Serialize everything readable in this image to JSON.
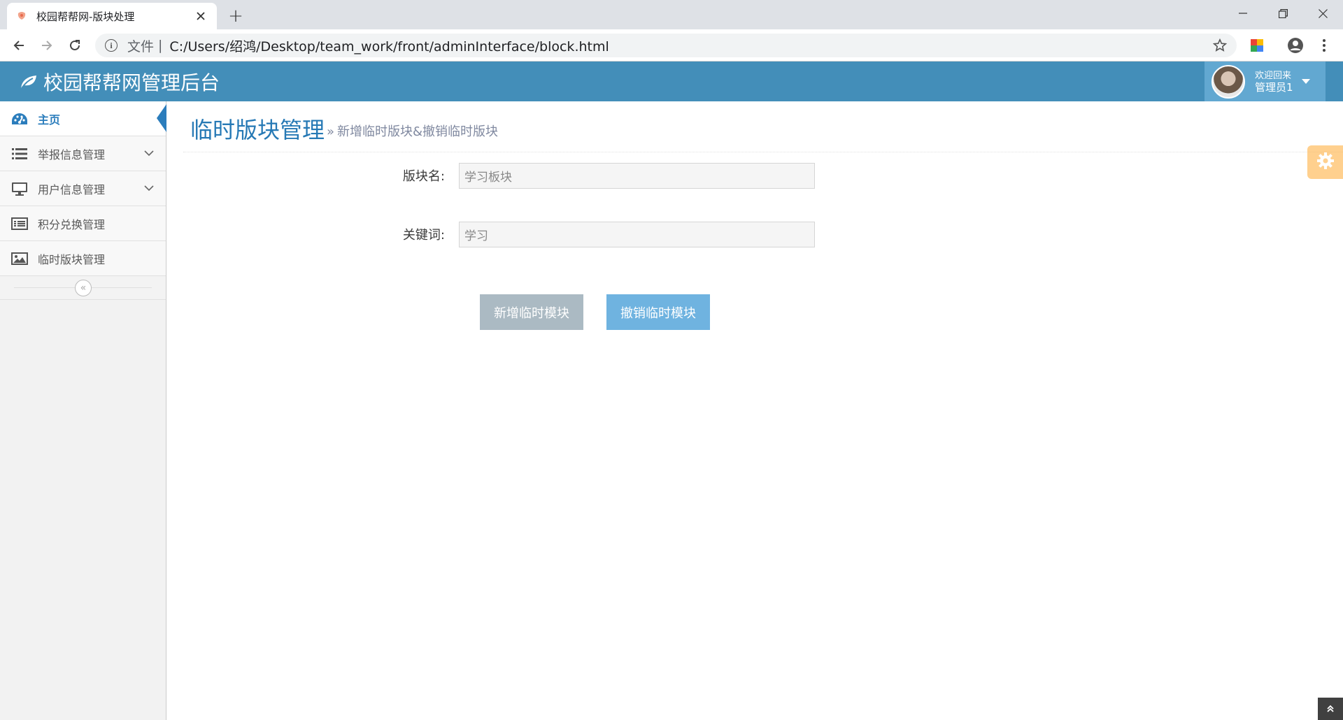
{
  "browser": {
    "tab_title": "校园帮帮网-版块处理",
    "new_tab_label": "+",
    "url_scheme_label": "文件",
    "url_separator": "|",
    "url": "C:/Users/绍鸿/Desktop/team_work/front/adminInterface/block.html"
  },
  "header": {
    "brand": "校园帮帮网管理后台",
    "user_welcome": "欢迎回来",
    "user_name": "管理员1"
  },
  "sidebar": {
    "items": [
      {
        "label": "主页",
        "icon": "dashboard-icon",
        "active": true
      },
      {
        "label": "举报信息管理",
        "icon": "list-icon",
        "has_children": true
      },
      {
        "label": "用户信息管理",
        "icon": "desktop-icon",
        "has_children": true
      },
      {
        "label": "积分兑换管理",
        "icon": "list-alt-icon"
      },
      {
        "label": "临时版块管理",
        "icon": "picture-icon"
      }
    ],
    "collapse_symbol": "«"
  },
  "page": {
    "title": "临时版块管理",
    "subtitle_prefix": "»",
    "subtitle": "新增临时版块&撤销临时版块"
  },
  "form": {
    "block_name_label": "版块名:",
    "block_name_value": "学习板块",
    "keyword_label": "关键词:",
    "keyword_value": "学习",
    "add_button": "新增临时模块",
    "remove_button": "撤销临时模块"
  },
  "colors": {
    "header_bg": "#438eb9",
    "user_box_bg": "#62a8d1",
    "title_color": "#2679b5",
    "add_button_bg": "#abbac3",
    "remove_button_bg": "#6fb3e0",
    "settings_tab_bg": "#ffb752"
  }
}
